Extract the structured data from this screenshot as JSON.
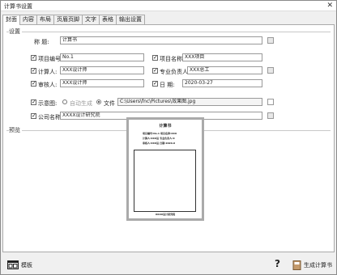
{
  "window": {
    "title": "计算书设置",
    "close_glyph": "✕"
  },
  "tabs": [
    {
      "label": "封面",
      "active": true
    },
    {
      "label": "内容",
      "active": false
    },
    {
      "label": "布局",
      "active": false
    },
    {
      "label": "页眉页脚",
      "active": false
    },
    {
      "label": "文字",
      "active": false
    },
    {
      "label": "表格",
      "active": false
    },
    {
      "label": "输出设置",
      "active": false
    }
  ],
  "settings": {
    "section_label": "设置",
    "name": {
      "label": "称    题:",
      "value": "计算书"
    },
    "project_no": {
      "label": "项目编号:",
      "value": "No.1",
      "checked": true
    },
    "project_name": {
      "label": "项目名称:",
      "value": "XXX项目",
      "checked": true
    },
    "calculator": {
      "label": "计算人:",
      "value": "XXX设计师",
      "checked": true
    },
    "responsible": {
      "label": "专业负责人:",
      "value": "XXX总工",
      "checked": true
    },
    "reviewer": {
      "label": "审核人:",
      "value": "XXX设计师",
      "checked": true
    },
    "date": {
      "label": "日    期:",
      "value": "2020-03-27",
      "checked": true
    },
    "diagram": {
      "label": "示意图:",
      "checked": true,
      "auto_label": "自动生成",
      "file_label": "文件",
      "selected": "文件",
      "path": "C:\\Users\\fnc\\Pictures\\效果图.jpg"
    },
    "company": {
      "label": "公司名称:",
      "value": "XXXX设计研究院",
      "checked": true
    }
  },
  "preview": {
    "section_label": "预览",
    "title": "计算书",
    "line1": "项目编号:No.1   项目名称:XXX",
    "line2": "计算人:XXX设   专业负责人:X",
    "line3": "审核人:XXX设   日期:2020-0",
    "footer": "XXXX设计研究院"
  },
  "footer": {
    "template_label": "模板",
    "help_glyph": "?",
    "generate_label": "生成计算书"
  }
}
